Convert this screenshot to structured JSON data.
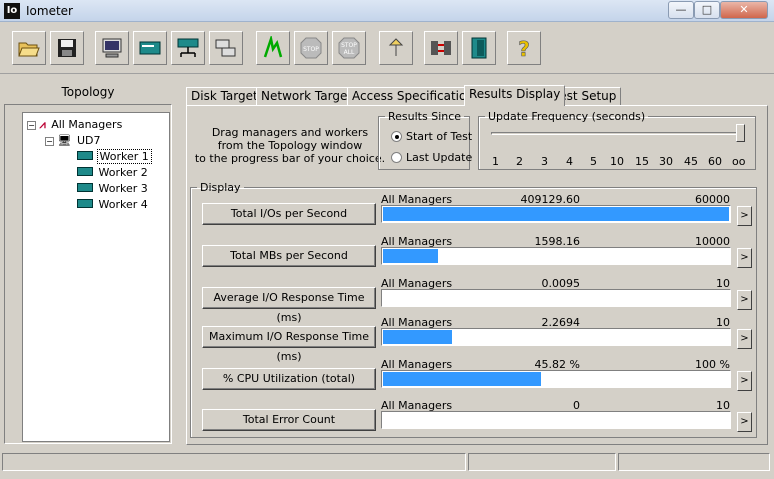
{
  "window": {
    "title": "Iometer",
    "icon_text": "Io",
    "minimize": "—",
    "maximize": "□",
    "close": "✕"
  },
  "toolbar": {
    "buttons": [
      {
        "name": "open-icon"
      },
      {
        "name": "save-icon"
      },
      {
        "name": "new-manager-icon"
      },
      {
        "name": "new-disk-worker-icon"
      },
      {
        "name": "new-network-worker-icon"
      },
      {
        "name": "duplicate-worker-icon"
      },
      {
        "name": "start-tests-icon"
      },
      {
        "name": "stop-icon",
        "label": "STOP"
      },
      {
        "name": "stop-all-icon",
        "label": "STOP",
        "label2": "ALL"
      },
      {
        "name": "reset-workers-icon"
      },
      {
        "name": "disconnect-icon"
      },
      {
        "name": "exit-icon"
      },
      {
        "name": "help-icon",
        "label": "?"
      }
    ]
  },
  "topology": {
    "header": "Topology",
    "root": "All Managers",
    "manager": "UD7",
    "workers": [
      "Worker 1",
      "Worker 2",
      "Worker 3",
      "Worker 4"
    ]
  },
  "tabs": [
    "Disk Targets",
    "Network Targets",
    "Access Specifications",
    "Results Display",
    "Test Setup"
  ],
  "active_tab": "Results Display",
  "drag_info": {
    "line1": "Drag managers and workers",
    "line2": "from the Topology window",
    "line3": "to the progress bar of your choice."
  },
  "results_since": {
    "legend": "Results Since",
    "options": [
      "Start of Test",
      "Last Update"
    ],
    "selected": "Start of Test"
  },
  "update_frequency": {
    "legend": "Update Frequency (seconds)",
    "ticks": [
      "1",
      "2",
      "3",
      "4",
      "5",
      "10",
      "15",
      "30",
      "45",
      "60",
      "oo"
    ],
    "selected": "oo"
  },
  "display": {
    "legend": "Display",
    "metrics": [
      {
        "label": "Total I/Os per Second",
        "manager": "All Managers",
        "value": "409129.60",
        "max": "60000",
        "fill": 1.0
      },
      {
        "label": "Total MBs per Second",
        "manager": "All Managers",
        "value": "1598.16",
        "max": "10000",
        "fill": 0.16
      },
      {
        "label": "Average I/O Response Time (ms)",
        "manager": "All Managers",
        "value": "0.0095",
        "max": "10",
        "fill": 0.0
      },
      {
        "label": "Maximum I/O Response Time (ms)",
        "manager": "All Managers",
        "value": "2.2694",
        "max": "10",
        "fill": 0.2
      },
      {
        "label": "% CPU Utilization (total)",
        "manager": "All Managers",
        "value": "45.82 %",
        "max": "100 %",
        "fill": 0.458
      },
      {
        "label": "Total Error Count",
        "manager": "All Managers",
        "value": "0",
        "max": "10",
        "fill": 0.0
      }
    ],
    "arrow": ">"
  },
  "colors": {
    "bar_fill": "#3399ff",
    "face": "#d4d0c8"
  }
}
